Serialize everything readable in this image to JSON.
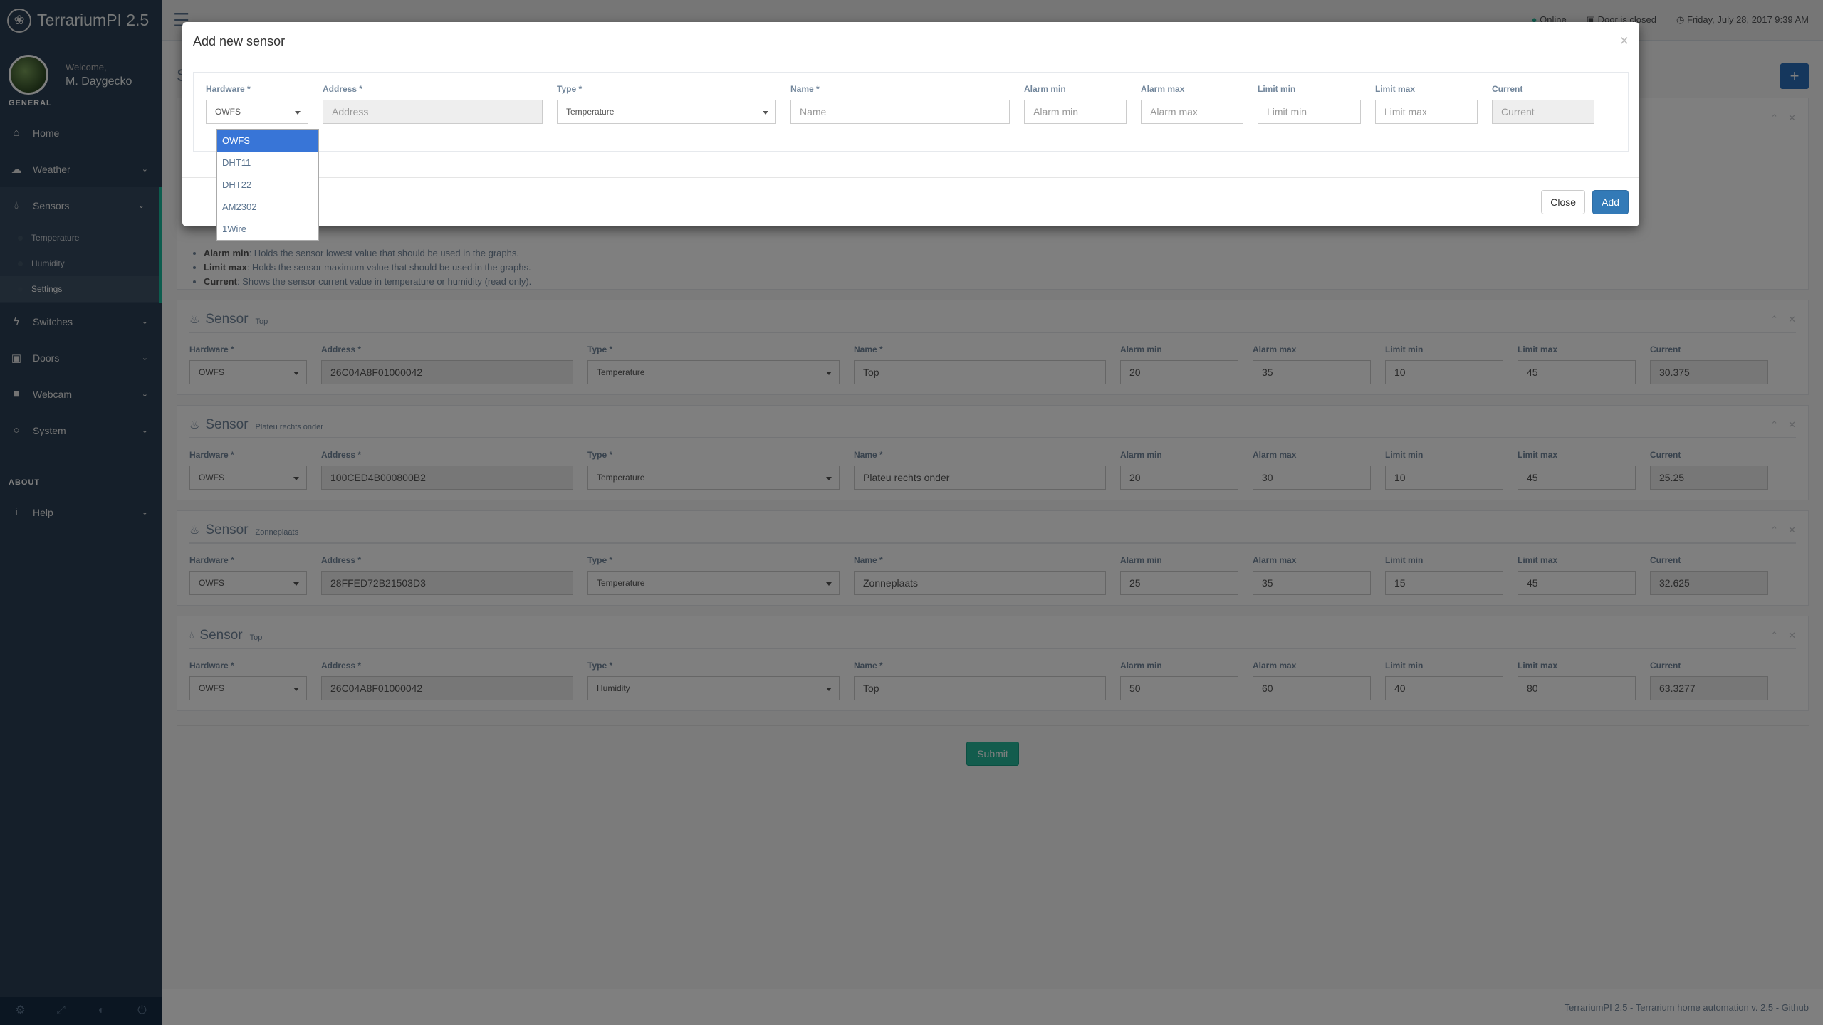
{
  "app": {
    "title": "TerrariumPI 2.5"
  },
  "profile": {
    "welcome": "Welcome,",
    "name": "M. Daygecko"
  },
  "sidebar": {
    "general_title": "GENERAL",
    "items": [
      {
        "label": "Home",
        "icon": "home-icon"
      },
      {
        "label": "Weather",
        "icon": "cloud-icon"
      },
      {
        "label": "Sensors",
        "icon": "tint-icon"
      },
      {
        "label": "Switches",
        "icon": "bolt-icon"
      },
      {
        "label": "Doors",
        "icon": "lock-icon"
      },
      {
        "label": "Webcam",
        "icon": "video-icon"
      },
      {
        "label": "System",
        "icon": "lightbulb-icon"
      }
    ],
    "sensor_sub": [
      "Temperature",
      "Humidity",
      "Settings"
    ],
    "about_title": "ABOUT",
    "help_label": "Help"
  },
  "topbar": {
    "online": "Online",
    "door": "Door is closed",
    "datetime": "Friday, July 28, 2017 9:39 AM"
  },
  "help_items": [
    {
      "term": "Alarm min",
      "text": ": Holds the sensor lowest value that should be used in the graphs."
    },
    {
      "term": "Limit max",
      "text": ": Holds the sensor maximum value that should be used in the graphs."
    },
    {
      "term": "Current",
      "text": ": Shows the sensor current value in temperature or humidity (read only)."
    }
  ],
  "labels": {
    "hardware": "Hardware *",
    "address": "Address *",
    "type": "Type *",
    "name": "Name *",
    "alarm_min": "Alarm min",
    "alarm_max": "Alarm max",
    "limit_min": "Limit min",
    "limit_max": "Limit max",
    "current": "Current",
    "sensor": "Sensor"
  },
  "sensors": [
    {
      "subtitle": "Top",
      "hardware": "OWFS",
      "address": "26C04A8F01000042",
      "type": "Temperature",
      "name": "Top",
      "alarm_min": "20",
      "alarm_max": "35",
      "limit_min": "10",
      "limit_max": "45",
      "current": "30.375"
    },
    {
      "subtitle": "Plateu rechts onder",
      "hardware": "OWFS",
      "address": "100CED4B000800B2",
      "type": "Temperature",
      "name": "Plateu rechts onder",
      "alarm_min": "20",
      "alarm_max": "30",
      "limit_min": "10",
      "limit_max": "45",
      "current": "25.25"
    },
    {
      "subtitle": "Zonneplaats",
      "hardware": "OWFS",
      "address": "28FFED72B21503D3",
      "type": "Temperature",
      "name": "Zonneplaats",
      "alarm_min": "25",
      "alarm_max": "35",
      "limit_min": "15",
      "limit_max": "45",
      "current": "32.625"
    },
    {
      "subtitle": "Top",
      "hardware": "OWFS",
      "address": "26C04A8F01000042",
      "type": "Humidity",
      "name": "Top",
      "alarm_min": "50",
      "alarm_max": "60",
      "limit_min": "40",
      "limit_max": "80",
      "current": "63.3277"
    }
  ],
  "submit_label": "Submit",
  "footer_text": "TerrariumPI 2.5 - Terrarium home automation v. 2.5 - Github",
  "modal": {
    "title": "Add new sensor",
    "hardware_value": "OWFS",
    "type_value": "Temperature",
    "placeholders": {
      "address": "Address",
      "name": "Name",
      "alarm_min": "Alarm min",
      "alarm_max": "Alarm max",
      "limit_min": "Limit min",
      "limit_max": "Limit max",
      "current": "Current"
    },
    "hardware_options": [
      "OWFS",
      "DHT11",
      "DHT22",
      "AM2302",
      "1Wire"
    ],
    "close_label": "Close",
    "add_label": "Add"
  }
}
